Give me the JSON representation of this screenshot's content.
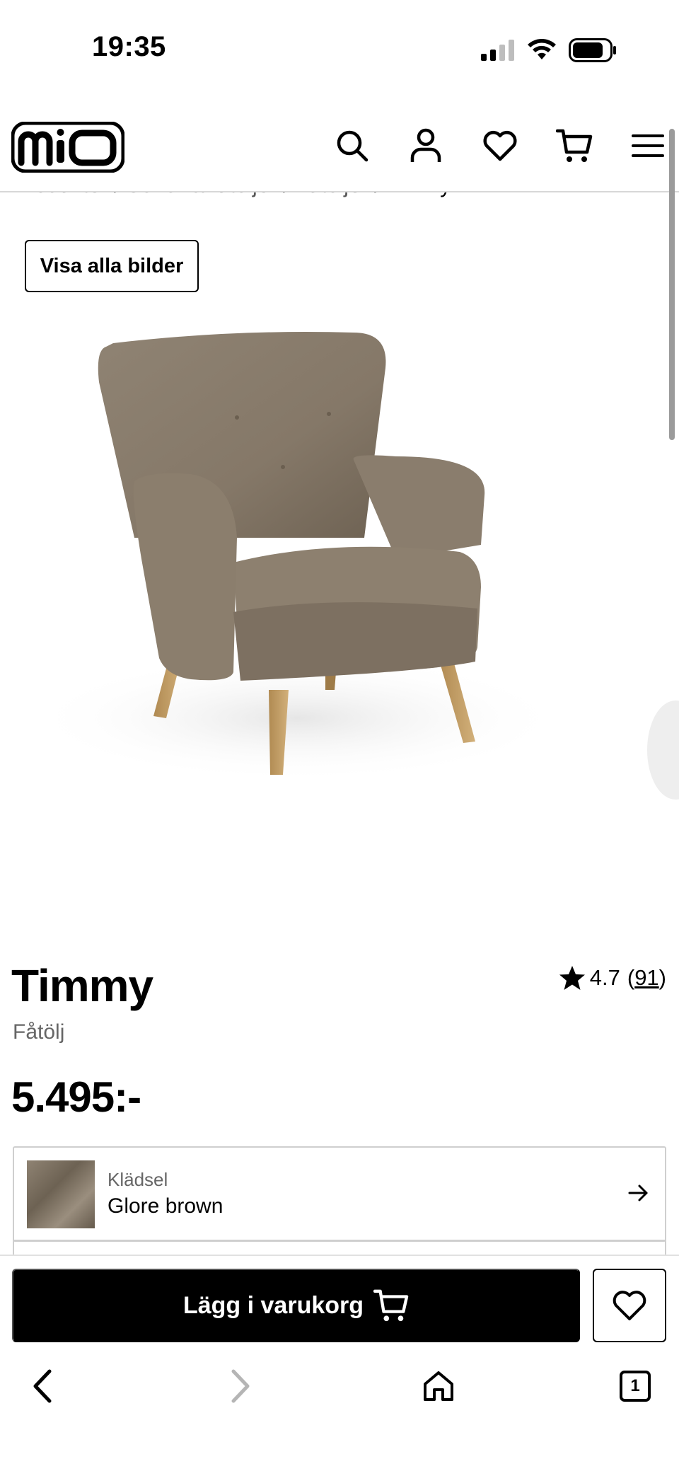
{
  "status_bar": {
    "time": "19:35"
  },
  "header": {
    "logo_text": "mio",
    "icons": [
      "search-icon",
      "account-icon",
      "heart-icon",
      "cart-icon",
      "menu-icon"
    ]
  },
  "breadcrumb": {
    "trail": "Produkter / Soffor & fåtöljer / Fåtöljer / ",
    "current": "Timmy"
  },
  "gallery": {
    "view_all_label": "Visa alla bilder"
  },
  "product": {
    "name": "Timmy",
    "category": "Fåtölj",
    "price": "5.495:-",
    "rating": "4.7",
    "review_count": "91",
    "rating_open": "(",
    "rating_close": ")"
  },
  "options": {
    "upholstery_label": "Klädsel",
    "upholstery_value": "Glore brown"
  },
  "actions": {
    "add_to_cart_label": "Lägg i varukorg"
  },
  "browser": {
    "tab_count": "1"
  }
}
